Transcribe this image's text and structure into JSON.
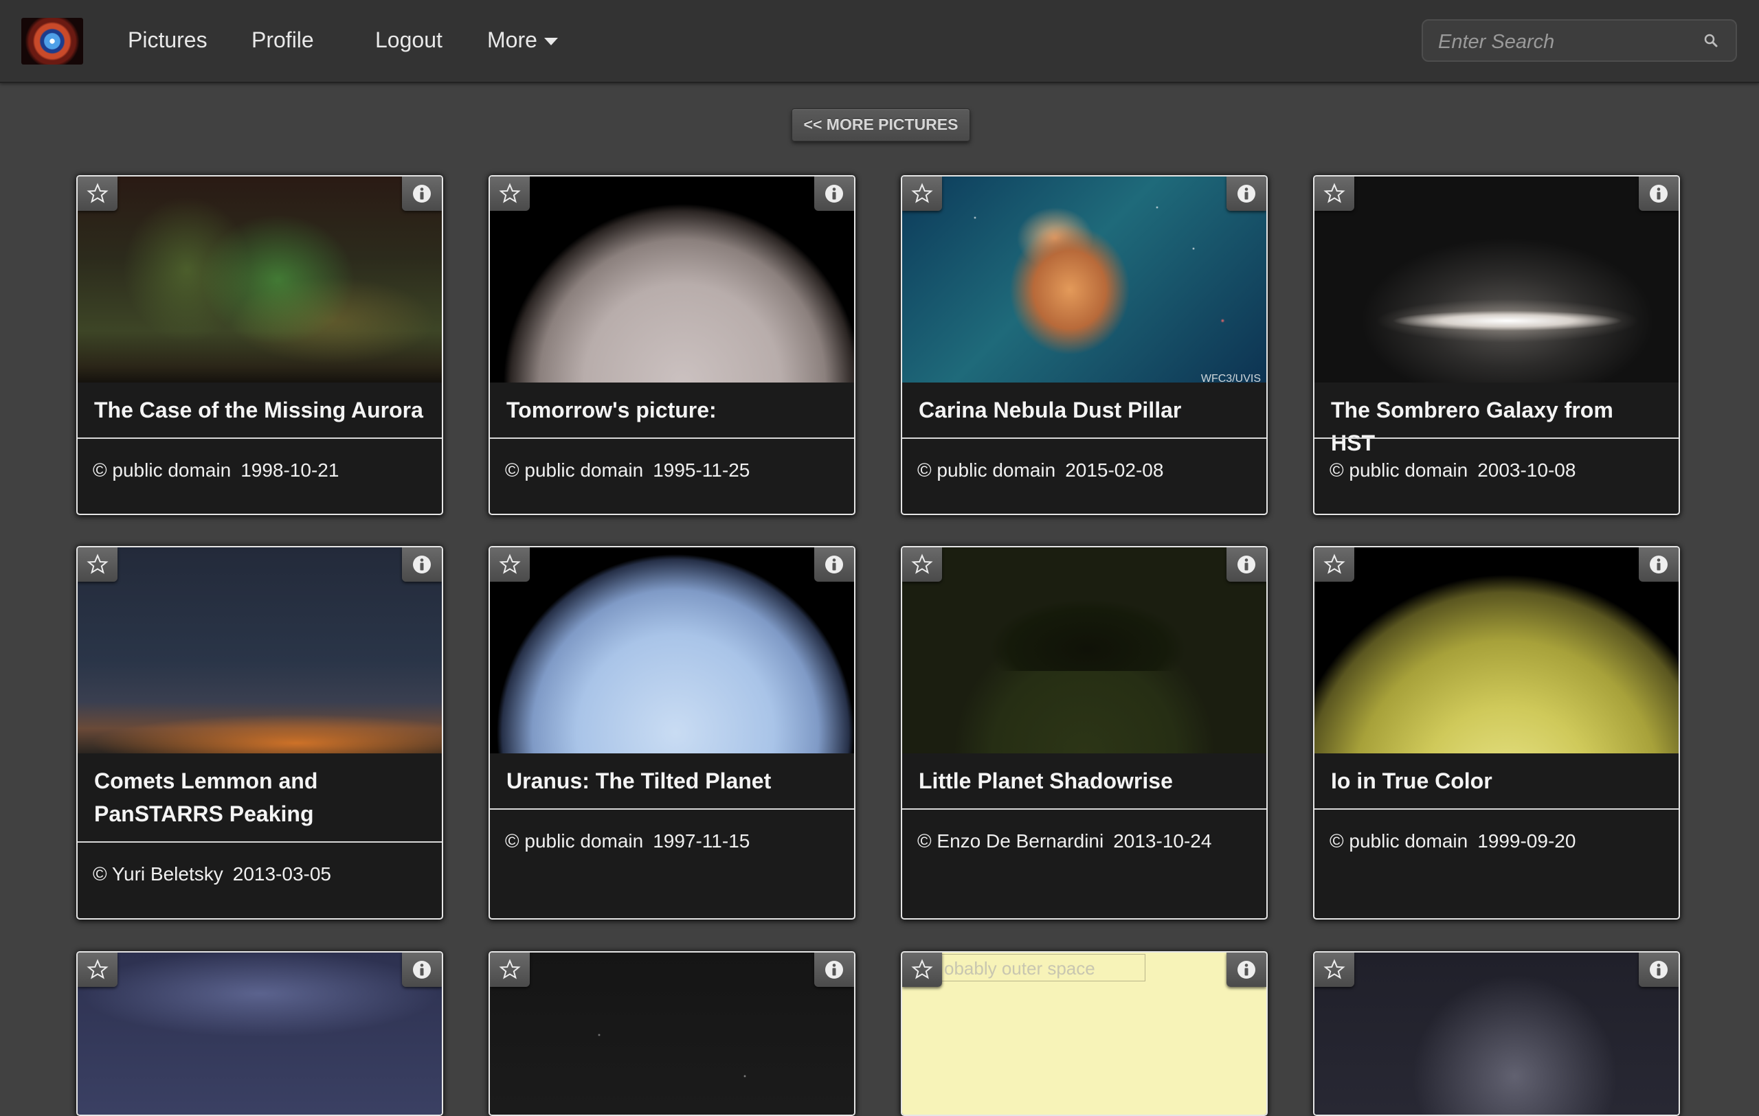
{
  "nav": {
    "links": [
      "Pictures",
      "Profile",
      "Logout",
      "More"
    ],
    "search_placeholder": "Enter Search"
  },
  "more_pictures_label": "<< MORE PICTURES",
  "cards": [
    {
      "title": "The Case of the Missing Aurora",
      "credit": "© public domain",
      "date": "1998-10-21"
    },
    {
      "title": "Tomorrow's picture:",
      "credit": "© public domain",
      "date": "1995-11-25"
    },
    {
      "title": "Carina Nebula Dust Pillar",
      "credit": "© public domain",
      "date": "2015-02-08"
    },
    {
      "title": "The Sombrero Galaxy from HST",
      "credit": "© public domain",
      "date": "2003-10-08"
    },
    {
      "title": "Comets Lemmon and PanSTARRS Peaking",
      "credit": "© Yuri Beletsky",
      "date": "2013-03-05"
    },
    {
      "title": "Uranus: The Tilted Planet",
      "credit": "© public domain",
      "date": "1997-11-15"
    },
    {
      "title": "Little Planet Shadowrise",
      "credit": "© Enzo De Bernardini",
      "date": "2013-10-24"
    },
    {
      "title": "Io in True Color",
      "credit": "© public domain",
      "date": "1999-09-20"
    }
  ],
  "partial_cards": [
    {
      "alt_text": ""
    },
    {
      "alt_text": ""
    },
    {
      "alt_text": "obably outer space"
    },
    {
      "alt_text": ""
    }
  ],
  "image_watermark": "WFC3/UVIS",
  "icons": {
    "star": "star-icon",
    "info": "info-icon",
    "search": "search-icon",
    "caret": "chevron-down-icon"
  },
  "colors": {
    "page_bg": "#414141",
    "navbar_bg": "#333333",
    "card_bg": "#1b1b1b"
  }
}
